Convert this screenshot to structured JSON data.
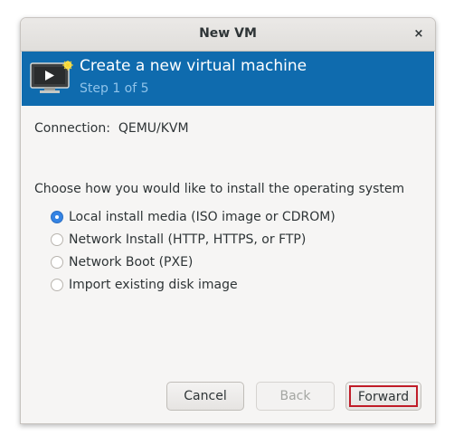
{
  "window": {
    "title": "New VM",
    "close_glyph": "×"
  },
  "header": {
    "title": "Create a new virtual machine",
    "step": "Step 1 of 5",
    "icon": "virtual-machine-icon",
    "background_color": "#0f6bae"
  },
  "connection": {
    "text": "Connection:  QEMU/KVM"
  },
  "install": {
    "prompt": "Choose how you would like to install the operating system",
    "options": [
      {
        "label": "Local install media (ISO image or CDROM)",
        "selected": true
      },
      {
        "label": "Network Install (HTTP, HTTPS, or FTP)",
        "selected": false
      },
      {
        "label": "Network Boot (PXE)",
        "selected": false
      },
      {
        "label": "Import existing disk image",
        "selected": false
      }
    ]
  },
  "buttons": {
    "cancel": "Cancel",
    "back": "Back",
    "forward": "Forward"
  },
  "colors": {
    "accent": "#3584e4",
    "forward_highlight": "#c01c28"
  }
}
